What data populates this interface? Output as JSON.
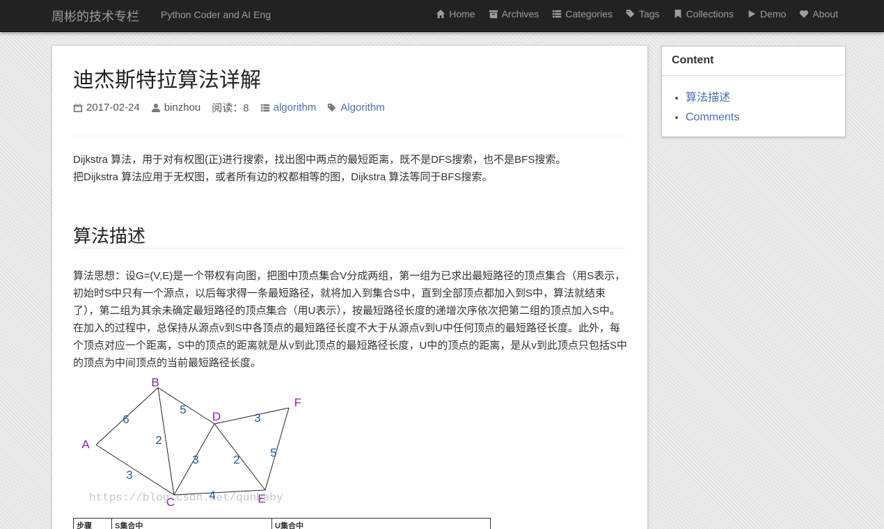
{
  "navbar": {
    "brand": "周彬的技术专栏",
    "tagline": "Python Coder and AI Eng",
    "items": [
      {
        "label": "Home",
        "icon": "home-icon"
      },
      {
        "label": "Archives",
        "icon": "archive-icon"
      },
      {
        "label": "Categories",
        "icon": "list-icon"
      },
      {
        "label": "Tags",
        "icon": "tags-icon"
      },
      {
        "label": "Collections",
        "icon": "bookmark-icon"
      },
      {
        "label": "Demo",
        "icon": "play-icon"
      },
      {
        "label": "About",
        "icon": "heart-icon"
      }
    ]
  },
  "post": {
    "title": "迪杰斯特拉算法详解",
    "date": "2017-02-24",
    "author": "binzhou",
    "reads": "阅读：8",
    "category": "algorithm",
    "tag": "Algorithm",
    "intro_line1": "Dijkstra 算法，用于对有权图(正)进行搜索，找出图中两点的最短距离，既不是DFS搜索，也不是BFS搜索。",
    "intro_line2": "把Dijkstra 算法应用于无权图，或者所有边的权都相等的图，Dijkstra 算法等同于BFS搜索。",
    "section_heading": "算法描述",
    "paragraph": "算法思想：设G=(V,E)是一个带权有向图，把图中顶点集合V分成两组，第一组为已求出最短路径的顶点集合（用S表示，初始时S中只有一个源点，以后每求得一条最短路径，就将加入到集合S中，直到全部顶点都加入到S中，算法就结束了），第二组为其余未确定最短路径的顶点集合（用U表示），按最短路径长度的递增次序依次把第二组的顶点加入S中。在加入的过程中，总保持从源点v到S中各顶点的最短路径长度不大于从源点v到U中任何顶点的最短路径长度。此外，每个顶点对应一个距离，S中的顶点的距离就是从v到此顶点的最短路径长度，U中的顶点的距离，是从v到此顶点只包括S中的顶点为中间顶点的当前最短路径长度。",
    "watermark": "https://blog.csdn.net/qunbaby",
    "table_headers": [
      "步骤",
      "S集合中",
      "U集合中"
    ]
  },
  "graph": {
    "nodes": [
      "A",
      "B",
      "C",
      "D",
      "E",
      "F"
    ],
    "edges": [
      {
        "from": "A",
        "to": "B",
        "weight": "6"
      },
      {
        "from": "A",
        "to": "C",
        "weight": "3"
      },
      {
        "from": "B",
        "to": "C",
        "weight": "2"
      },
      {
        "from": "B",
        "to": "D",
        "weight": "5"
      },
      {
        "from": "C",
        "to": "D",
        "weight": "3"
      },
      {
        "from": "C",
        "to": "E",
        "weight": "4"
      },
      {
        "from": "D",
        "to": "E",
        "weight": "2"
      },
      {
        "from": "D",
        "to": "F",
        "weight": "3"
      },
      {
        "from": "E",
        "to": "F",
        "weight": "5"
      }
    ],
    "node_color": "#8b1fa9",
    "weight_color": "#1a5aa6"
  },
  "sidebar": {
    "heading": "Content",
    "items": [
      "算法描述",
      "Comments"
    ]
  }
}
